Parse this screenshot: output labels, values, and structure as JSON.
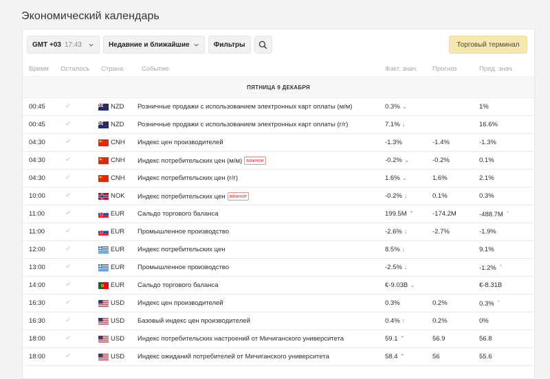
{
  "page": {
    "title": "Экономический календарь"
  },
  "toolbar": {
    "timezone_label": "GMT +03",
    "timezone_time": "17:43",
    "period_label": "Недавние и ближайшие",
    "filters_label": "Фильтры",
    "terminal_label": "Торговый терминал"
  },
  "columns": {
    "time": "Время",
    "remaining": "Осталось",
    "country": "Страна",
    "event": "Событие",
    "actual": "Факт. знач.",
    "forecast": "Прогноз",
    "previous": "Пред. знач."
  },
  "date_header": "ПЯТНИЦА 9 ДЕКАБРЯ",
  "badge_label": "важное",
  "rows": [
    {
      "time": "00:45",
      "flag": "nz",
      "currency": "NZD",
      "event": "Розничные продажи с использованием электронных карт оплаты (м/м)",
      "badge": "",
      "actual": "0.3%",
      "arrow": "double-down",
      "forecast": "",
      "previous": "1%",
      "rev": false
    },
    {
      "time": "00:45",
      "flag": "nz",
      "currency": "NZD",
      "event": "Розничные продажи с использованием электронных карт оплаты (г/г)",
      "badge": "",
      "actual": "7.1%",
      "arrow": "down",
      "forecast": "",
      "previous": "16.6%",
      "rev": false
    },
    {
      "time": "04:30",
      "flag": "cn",
      "currency": "CNH",
      "event": "Индекс цен производителей",
      "badge": "",
      "actual": "-1.3%",
      "arrow": "",
      "forecast": "-1.4%",
      "previous": "-1.3%",
      "rev": false
    },
    {
      "time": "04:30",
      "flag": "cn",
      "currency": "CNH",
      "event": "Индекс потребительских цен (м/м)",
      "badge": "важное",
      "actual": "-0.2%",
      "arrow": "double-down",
      "forecast": "-0.2%",
      "previous": "0.1%",
      "rev": false
    },
    {
      "time": "04:30",
      "flag": "cn",
      "currency": "CNH",
      "event": "Индекс потребительских цен (г/г)",
      "badge": "",
      "actual": "1.6%",
      "arrow": "double-down",
      "forecast": "1.6%",
      "previous": "2.1%",
      "rev": false
    },
    {
      "time": "10:00",
      "flag": "no",
      "currency": "NOK",
      "event": "Индекс потребительских цен",
      "badge": "важное",
      "actual": "-0.2%",
      "arrow": "down",
      "forecast": "0.1%",
      "previous": "0.3%",
      "rev": false
    },
    {
      "time": "11:00",
      "flag": "sk",
      "currency": "EUR",
      "event": "Сальдо торгового баланса",
      "badge": "",
      "actual": "199.5M",
      "arrow": "double-up",
      "forecast": "-174.2M",
      "previous": "-488.7M",
      "rev": true
    },
    {
      "time": "11:00",
      "flag": "sk",
      "currency": "EUR",
      "event": "Промышленное производство",
      "badge": "",
      "actual": "-2.6%",
      "arrow": "down",
      "forecast": "-2.7%",
      "previous": "-1.9%",
      "rev": false
    },
    {
      "time": "12:00",
      "flag": "gr",
      "currency": "EUR",
      "event": "Индекс потребительских цен",
      "badge": "",
      "actual": "8.5%",
      "arrow": "down",
      "forecast": "",
      "previous": "9.1%",
      "rev": false
    },
    {
      "time": "13:00",
      "flag": "gr",
      "currency": "EUR",
      "event": "Промышленное производство",
      "badge": "",
      "actual": "-2.5%",
      "arrow": "down",
      "forecast": "",
      "previous": "-1.2%",
      "rev": true
    },
    {
      "time": "14:00",
      "flag": "pt",
      "currency": "EUR",
      "event": "Сальдо торгового баланса",
      "badge": "",
      "actual": "€-9.03B",
      "arrow": "double-down",
      "forecast": "",
      "previous": "€-8.31B",
      "rev": false
    },
    {
      "time": "16:30",
      "flag": "us",
      "currency": "USD",
      "event": "Индекс цен производителей",
      "badge": "",
      "actual": "0.3%",
      "arrow": "",
      "forecast": "0.2%",
      "previous": "0.3%",
      "rev": true
    },
    {
      "time": "16:30",
      "flag": "us",
      "currency": "USD",
      "event": "Базовый индекс цен производителей",
      "badge": "",
      "actual": "0.4%",
      "arrow": "up",
      "forecast": "0.2%",
      "previous": "0%",
      "rev": false
    },
    {
      "time": "18:00",
      "flag": "us",
      "currency": "USD",
      "event": "Индекс потребительских настроений от Мичиганского университета",
      "badge": "",
      "actual": "59.1",
      "arrow": "double-up",
      "forecast": "56.9",
      "previous": "56.8",
      "rev": false
    },
    {
      "time": "18:00",
      "flag": "us",
      "currency": "USD",
      "event": "Индекс ожиданий потребителей от Мичиганского университета",
      "badge": "",
      "actual": "58.4",
      "arrow": "double-up",
      "forecast": "56",
      "previous": "55.6",
      "rev": false
    }
  ]
}
